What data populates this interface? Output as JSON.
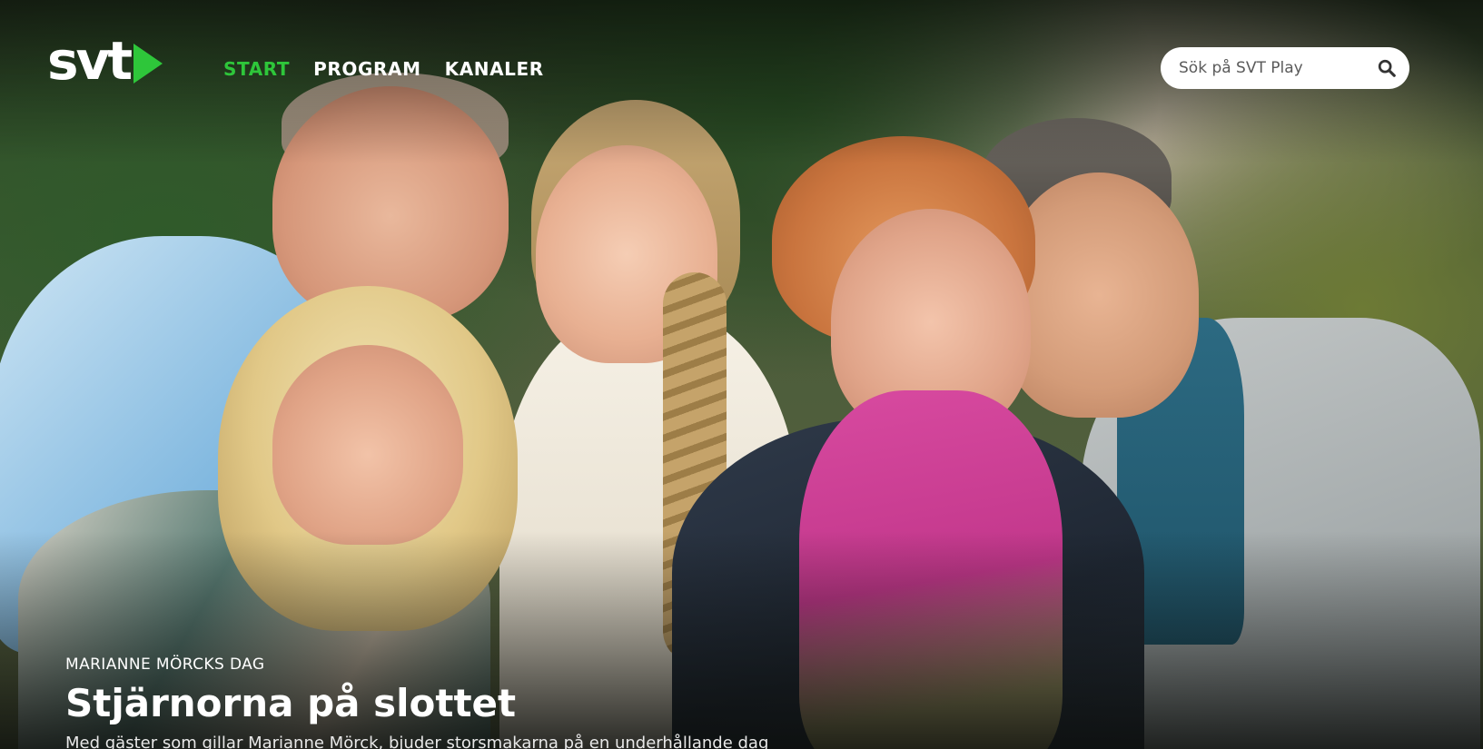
{
  "brand": {
    "logo_text": "svt",
    "accent_color": "#2ec63a"
  },
  "nav": {
    "items": [
      {
        "label": "START",
        "active": true
      },
      {
        "label": "PROGRAM",
        "active": false
      },
      {
        "label": "KANALER",
        "active": false
      }
    ]
  },
  "search": {
    "placeholder": "Sök på SVT Play",
    "icon": "search-icon"
  },
  "hero": {
    "kicker": "MARIANNE MÖRCKS DAG",
    "title": "Stjärnorna på slottet",
    "description": "Med gäster som gillar Marianne Mörck, bjuder storsmakarna på en underhållande dag"
  }
}
